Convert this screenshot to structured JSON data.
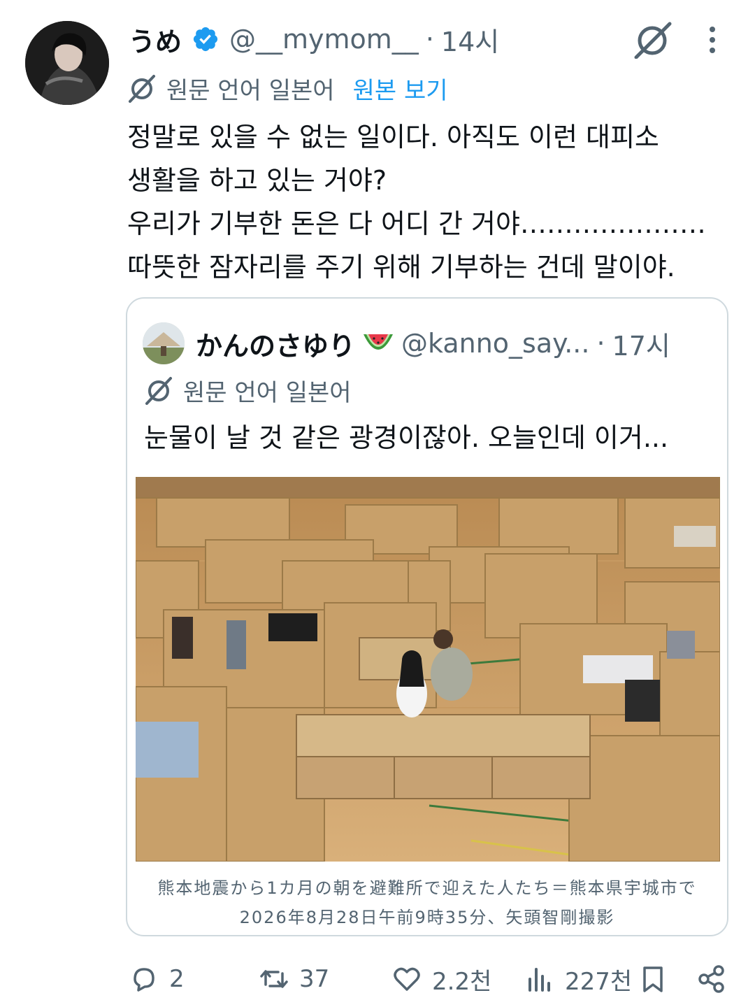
{
  "tweet": {
    "display_name": "うめ",
    "handle": "@__mymom__",
    "dot": "·",
    "time": "14시",
    "translated_label": "원문 언어 일본어",
    "show_original": "원본 보기",
    "text_lines": [
      "정말로 있을 수 없는 일이다. 아직도 이런 대피소",
      "생활을 하고 있는 거야?",
      "우리가 기부한 돈은 다 어디 간 거야…………………",
      "따뜻한 잠자리를 주기 위해 기부하는 건데 말이야."
    ]
  },
  "quote": {
    "display_name": "かんのさゆり",
    "handle": "@kanno_say...",
    "dot": "·",
    "time": "17시",
    "translated_label": "원문 언어 일본어",
    "text": "눈물이 날 것 같은 광경이잖아. 오늘인데 이거...",
    "caption_lines": [
      "熊本地震から1カ月の朝を避難所で迎えた人たち＝熊本県宇城市で",
      "2026年8月28日午前9時35分、矢頭智剛撮影"
    ]
  },
  "actions": {
    "replies": "2",
    "reposts": "37",
    "likes": "2.2천",
    "views": "227천"
  },
  "colors": {
    "accent": "#1d9bf0",
    "muted": "#536471",
    "text": "#0f1419",
    "border": "#cfd9de"
  },
  "icons": [
    "grok-icon",
    "more-icon",
    "translate-icon",
    "verified-badge-icon",
    "watermelon-emoji",
    "reply-icon",
    "repost-icon",
    "like-icon",
    "views-icon",
    "bookmark-icon",
    "share-icon"
  ]
}
